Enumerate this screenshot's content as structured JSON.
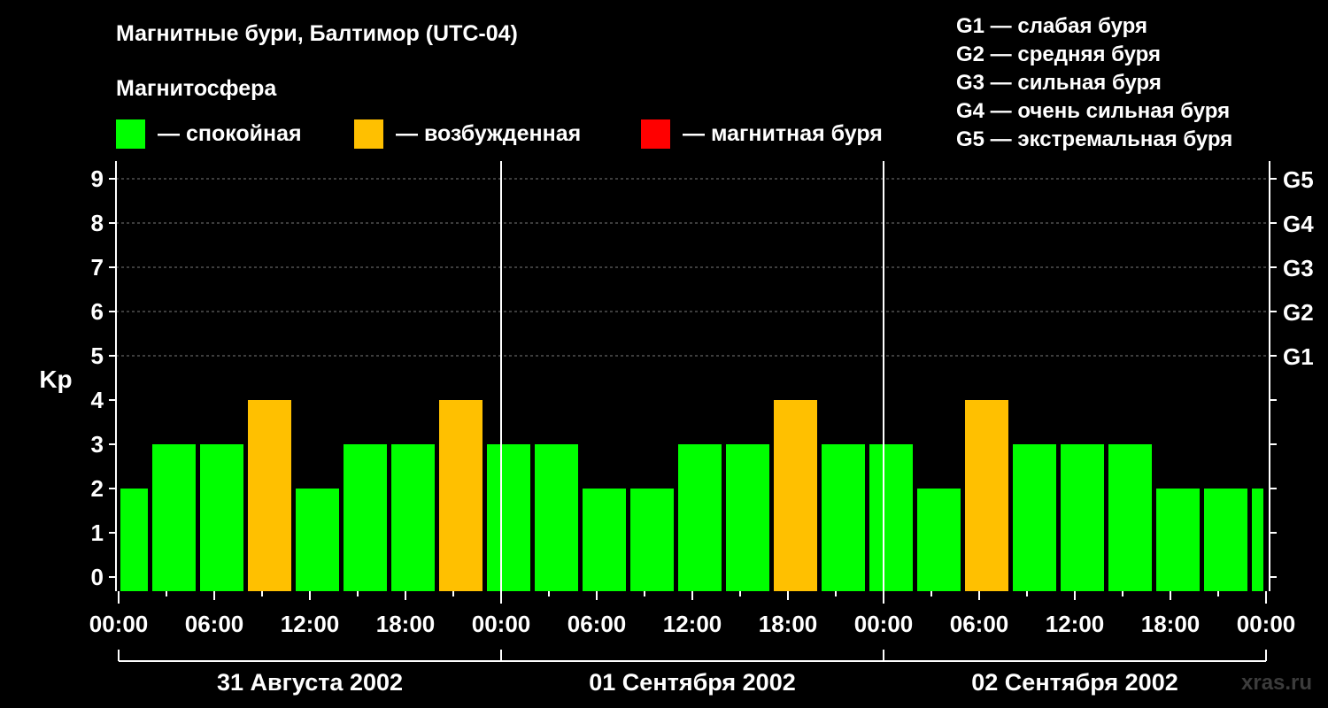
{
  "chart_data": {
    "type": "bar",
    "title": "Магнитные бури, Балтимор (UTC-04)",
    "legend_title": "Магнитосфера",
    "legend": [
      {
        "label": "— спокойная",
        "color": "#00ff00"
      },
      {
        "label": "— возбужденная",
        "color": "#ffc000"
      },
      {
        "label": "— магнитная буря",
        "color": "#ff0000"
      }
    ],
    "storm_levels": [
      "G1 — слабая буря",
      "G2 — средняя буря",
      "G3 — сильная буря",
      "G4 — очень сильная буря",
      "G5 — экстремальная буря"
    ],
    "ylabel": "Kp",
    "ylim": [
      0,
      9
    ],
    "yticks": [
      "0",
      "1",
      "2",
      "3",
      "4",
      "5",
      "6",
      "7",
      "8",
      "9"
    ],
    "right_ticks": [
      {
        "kp": 5,
        "label": "G1"
      },
      {
        "kp": 6,
        "label": "G2"
      },
      {
        "kp": 7,
        "label": "G3"
      },
      {
        "kp": 8,
        "label": "G4"
      },
      {
        "kp": 9,
        "label": "G5"
      }
    ],
    "grid": "horizontal dashed at Kp 5-9",
    "x_tick_labels": [
      "00:00",
      "06:00",
      "12:00",
      "18:00",
      "00:00",
      "06:00",
      "12:00",
      "18:00",
      "00:00",
      "06:00",
      "12:00",
      "18:00",
      "00:00"
    ],
    "days": [
      "31 Августа 2002",
      "01 Сентября 2002",
      "02 Сентября 2002"
    ],
    "bars": [
      {
        "start_hour": 0,
        "end_hour": 2,
        "kp": 2
      },
      {
        "start_hour": 2,
        "end_hour": 5,
        "kp": 3
      },
      {
        "start_hour": 5,
        "end_hour": 8,
        "kp": 3
      },
      {
        "start_hour": 8,
        "end_hour": 11,
        "kp": 4
      },
      {
        "start_hour": 11,
        "end_hour": 14,
        "kp": 2
      },
      {
        "start_hour": 14,
        "end_hour": 17,
        "kp": 3
      },
      {
        "start_hour": 17,
        "end_hour": 20,
        "kp": 3
      },
      {
        "start_hour": 20,
        "end_hour": 23,
        "kp": 4
      },
      {
        "start_hour": 23,
        "end_hour": 26,
        "kp": 3
      },
      {
        "start_hour": 26,
        "end_hour": 29,
        "kp": 3
      },
      {
        "start_hour": 29,
        "end_hour": 32,
        "kp": 2
      },
      {
        "start_hour": 32,
        "end_hour": 35,
        "kp": 2
      },
      {
        "start_hour": 35,
        "end_hour": 38,
        "kp": 3
      },
      {
        "start_hour": 38,
        "end_hour": 41,
        "kp": 3
      },
      {
        "start_hour": 41,
        "end_hour": 44,
        "kp": 4
      },
      {
        "start_hour": 44,
        "end_hour": 47,
        "kp": 3
      },
      {
        "start_hour": 47,
        "end_hour": 50,
        "kp": 3
      },
      {
        "start_hour": 50,
        "end_hour": 53,
        "kp": 2
      },
      {
        "start_hour": 53,
        "end_hour": 56,
        "kp": 4
      },
      {
        "start_hour": 56,
        "end_hour": 59,
        "kp": 3
      },
      {
        "start_hour": 59,
        "end_hour": 62,
        "kp": 3
      },
      {
        "start_hour": 62,
        "end_hour": 65,
        "kp": 3
      },
      {
        "start_hour": 65,
        "end_hour": 68,
        "kp": 2
      },
      {
        "start_hour": 68,
        "end_hour": 71,
        "kp": 2
      },
      {
        "start_hour": 71,
        "end_hour": 72,
        "kp": 2
      }
    ],
    "colors": {
      "quiet": "#00ff00",
      "active": "#ffc000",
      "storm": "#ff0000"
    }
  },
  "watermark": "xras.ru"
}
